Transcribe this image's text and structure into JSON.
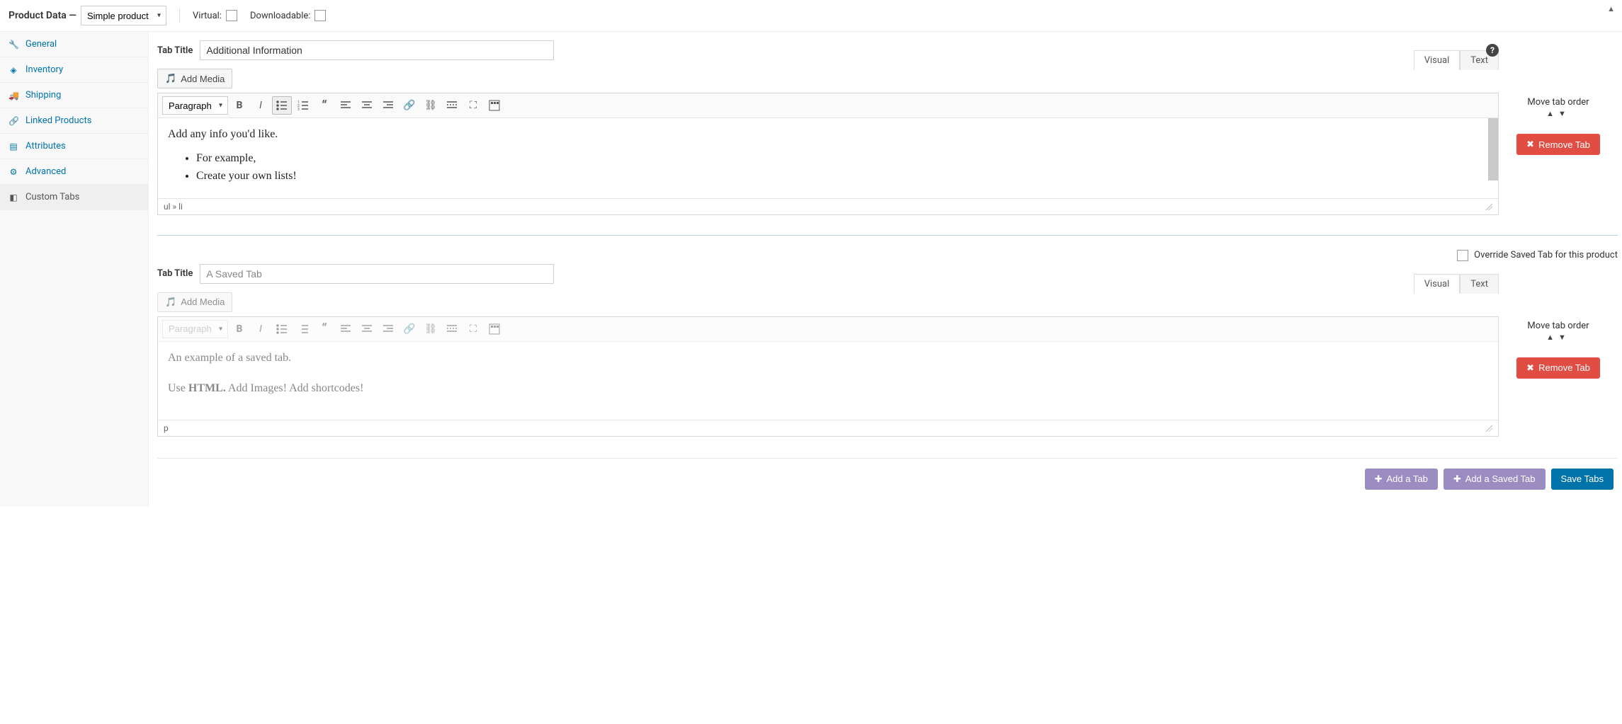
{
  "header": {
    "title": "Product Data —",
    "product_type": "Simple product",
    "virtual_label": "Virtual:",
    "downloadable_label": "Downloadable:"
  },
  "sidebar": {
    "items": [
      {
        "icon": "🔧",
        "label": "General"
      },
      {
        "icon": "◈",
        "label": "Inventory"
      },
      {
        "icon": "🚚",
        "label": "Shipping"
      },
      {
        "icon": "🔗",
        "label": "Linked Products"
      },
      {
        "icon": "▤",
        "label": "Attributes"
      },
      {
        "icon": "⚙",
        "label": "Advanced"
      },
      {
        "icon": "◧",
        "label": "Custom Tabs"
      }
    ]
  },
  "editor_common": {
    "tab_title_label": "Tab Title",
    "add_media_label": "Add Media",
    "visual_label": "Visual",
    "text_label": "Text",
    "paragraph_label": "Paragraph",
    "move_tab_label": "Move tab order",
    "remove_tab_label": "Remove Tab",
    "help_glyph": "?"
  },
  "tab1": {
    "title_value": "Additional Information",
    "content_intro": "Add any info you'd like.",
    "content_list": [
      "For example,",
      "Create your own lists!"
    ],
    "status_path": "ul » li"
  },
  "tab2": {
    "title_value": "A Saved Tab",
    "override_label": "Override Saved Tab for this product",
    "content_line1": "An example of a saved tab.",
    "content_line2_pre": "Use ",
    "content_line2_bold": "HTML.",
    "content_line2_post": " Add Images! Add shortcodes!",
    "status_path": "p"
  },
  "footer": {
    "add_tab": "Add a Tab",
    "add_saved_tab": "Add a Saved Tab",
    "save_tabs": "Save Tabs"
  },
  "icons": {
    "plus": "✚",
    "x": "✖",
    "caret_up": "▲",
    "caret_down": "▼"
  }
}
